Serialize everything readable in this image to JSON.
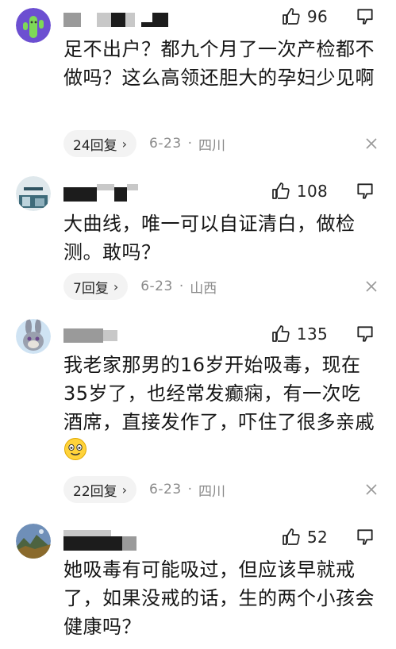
{
  "comments": [
    {
      "likes": "96",
      "text": "足不出户？都九个月了一次产检都不做吗？这么高领还胆大的孕妇少见啊",
      "replies": "24回复",
      "date": "6-23",
      "separator": "·",
      "location": "四川",
      "avatar_icon": "cactus-avatar-icon"
    },
    {
      "likes": "108",
      "text": "大曲线，唯一可以自证清白，做检测。敢吗？",
      "replies": "7回复",
      "date": "6-23",
      "separator": "·",
      "location": "山西",
      "avatar_icon": "photo-avatar-icon"
    },
    {
      "likes": "135",
      "text": "我老家那男的16岁开始吸毒，现在35岁了，也经常发癫痫，有一次吃酒席，直接发作了，吓住了很多亲戚",
      "replies": "22回复",
      "date": "6-23",
      "separator": "·",
      "location": "四川",
      "avatar_icon": "bunny-avatar-icon"
    },
    {
      "likes": "52",
      "text": "她吸毒有可能吸过，但应该早就戒了，如果没戒的话，生的两个小孩会健康吗？",
      "avatar_icon": "mountain-avatar-icon"
    }
  ],
  "colors": {
    "text": "#161616",
    "meta": "#8a8a8a",
    "pill_bg": "#f3f3f3"
  }
}
